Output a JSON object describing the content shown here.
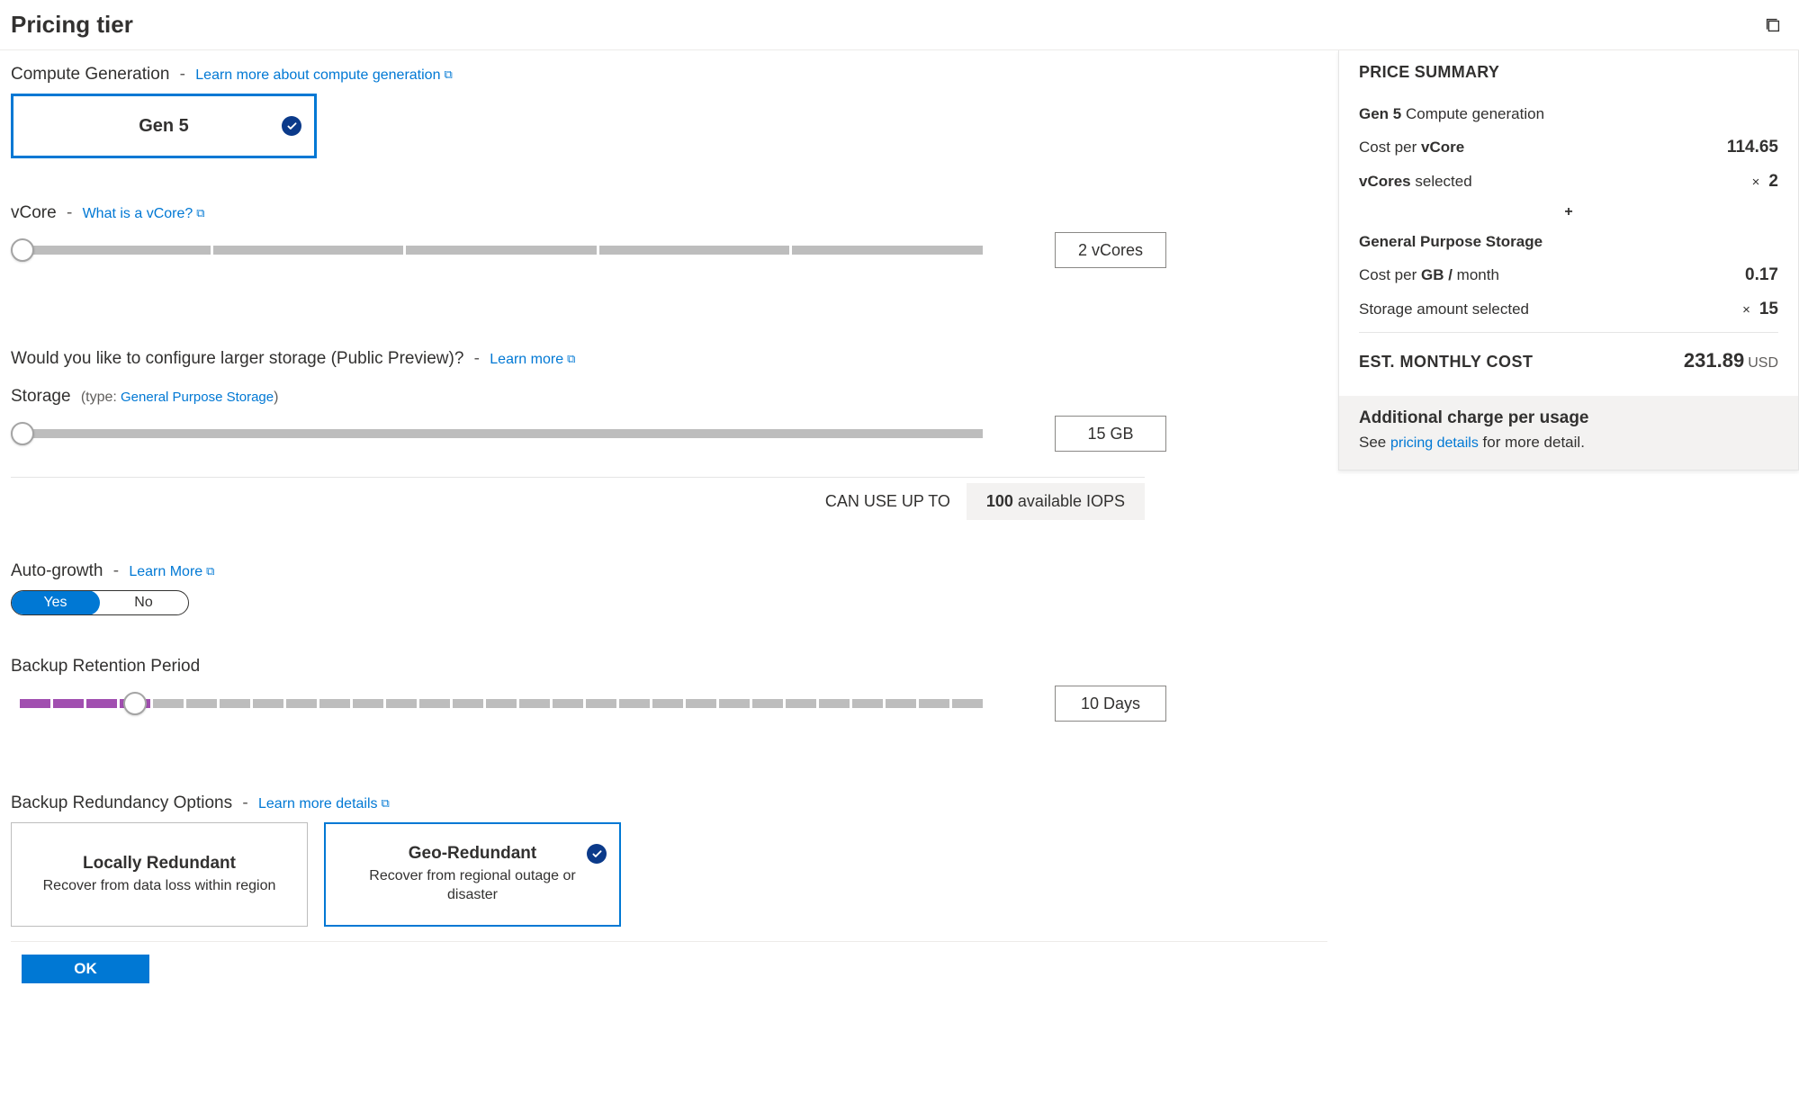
{
  "header": {
    "title": "Pricing tier"
  },
  "compute": {
    "label": "Compute Generation",
    "link": "Learn more about compute generation",
    "selected": "Gen 5"
  },
  "vcore": {
    "label": "vCore",
    "link": "What is a vCore?",
    "value_display": "2 vCores"
  },
  "larger_storage": {
    "label": "Would you like to configure larger storage (Public Preview)?",
    "link": "Learn more"
  },
  "storage": {
    "label": "Storage",
    "type_prefix": "(type:",
    "type_link": "General Purpose Storage",
    "type_suffix": ")",
    "value_display": "15 GB",
    "iops_label": "CAN USE UP TO",
    "iops_value": "100",
    "iops_suffix": " available IOPS"
  },
  "autogrowth": {
    "label": "Auto-growth",
    "link": "Learn More",
    "options": {
      "yes": "Yes",
      "no": "No"
    },
    "selected": "Yes"
  },
  "retention": {
    "label": "Backup Retention Period",
    "value_display": "10 Days"
  },
  "redundancy": {
    "label": "Backup Redundancy Options",
    "link": "Learn more details",
    "cards": [
      {
        "title": "Locally Redundant",
        "desc": "Recover from data loss within region",
        "selected": false
      },
      {
        "title": "Geo-Redundant",
        "desc": "Recover from regional outage or disaster",
        "selected": true
      }
    ]
  },
  "footer": {
    "ok": "OK"
  },
  "summary": {
    "title": "PRICE SUMMARY",
    "gen_label_bold": "Gen 5",
    "gen_label_rest": " Compute generation",
    "cpv_label_a": "Cost per ",
    "cpv_label_b": "vCore",
    "cpv_value": "114.65",
    "vcores_label_a": "vCores",
    "vcores_label_b": " selected",
    "vcores_value": "2",
    "plus": "+",
    "storage_heading": "General Purpose Storage",
    "cpgb_label_a": "Cost per ",
    "cpgb_label_b": "GB / ",
    "cpgb_label_c": "month",
    "cpgb_value": "0.17",
    "sa_label": "Storage amount selected",
    "sa_value": "15",
    "mult": "×",
    "total_label": "EST. MONTHLY COST",
    "total_value": "231.89",
    "total_currency": "USD",
    "addl_title": "Additional charge per usage",
    "addl_text_a": "See ",
    "addl_link": "pricing details",
    "addl_text_b": " for more detail."
  }
}
